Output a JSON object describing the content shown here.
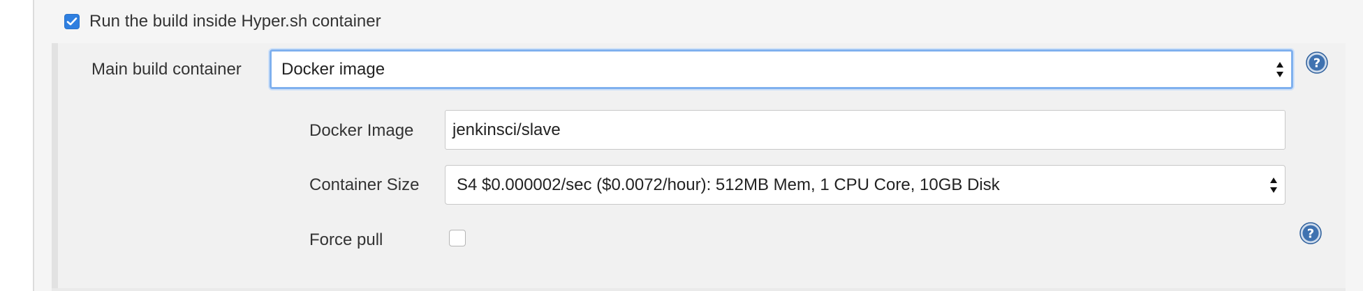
{
  "enable": {
    "label": "Run the build inside Hyper.sh container",
    "checked": true
  },
  "main_container": {
    "label": "Main build container",
    "selected": "Docker image",
    "help_icon": "question-circle-icon"
  },
  "docker_image": {
    "label": "Docker Image",
    "value": "jenkinsci/slave"
  },
  "container_size": {
    "label": "Container Size",
    "selected": "S4 $0.000002/sec ($0.0072/hour): 512MB Mem, 1 CPU Core, 10GB Disk"
  },
  "force_pull": {
    "label": "Force pull",
    "checked": false,
    "help_icon": "question-circle-icon"
  },
  "colors": {
    "checkbox_accent": "#2f7fe0",
    "focus_ring": "#7fb0ee",
    "help_icon": "#2b5d9a"
  }
}
